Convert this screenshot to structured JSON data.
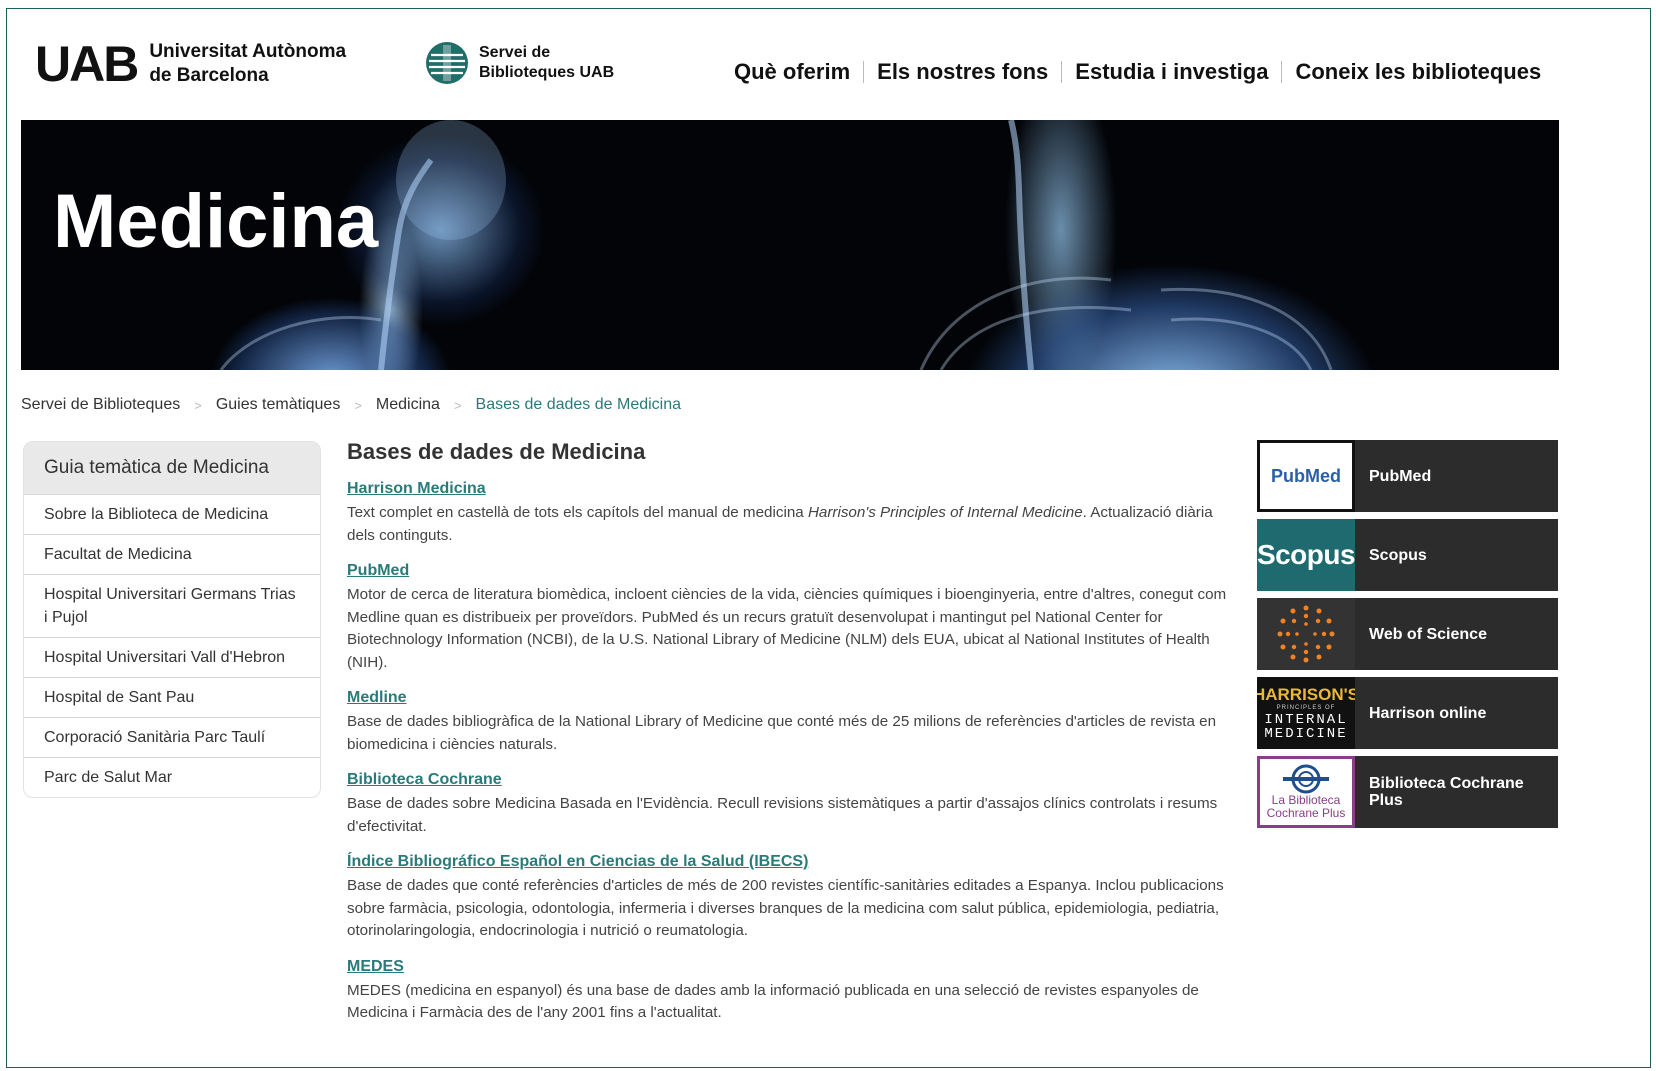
{
  "header": {
    "uab_mark": "UAB",
    "uab_line1": "Universitat Autònoma",
    "uab_line2": "de Barcelona",
    "sb_line1": "Servei de",
    "sb_line2": "Biblioteques UAB",
    "nav": [
      "Què oferim",
      "Els nostres fons",
      "Estudia i investiga",
      "Coneix les biblioteques"
    ]
  },
  "banner": {
    "title": "Medicina"
  },
  "breadcrumb": {
    "items": [
      "Servei de Biblioteques",
      "Guies temàtiques",
      "Medicina"
    ],
    "current": "Bases de dades de Medicina",
    "separator": ">"
  },
  "sidebar": {
    "title": "Guia temàtica de Medicina",
    "items": [
      "Sobre la Biblioteca de Medicina",
      "Facultat de Medicina",
      "Hospital Universitari Germans Trias i Pujol",
      "Hospital Universitari Vall d'Hebron",
      "Hospital de Sant Pau",
      "Corporació Sanitària Parc Taulí",
      "Parc de Salut Mar"
    ]
  },
  "main": {
    "heading": "Bases de dades de Medicina",
    "entries": [
      {
        "title": "Harrison Medicina",
        "desc_before": "Text complet en castellà de tots els capítols del manual de medicina ",
        "desc_italic": "Harrison's Principles of Internal Medicine",
        "desc_after": ". Actualizació diària dels continguts."
      },
      {
        "title": "PubMed",
        "desc": "Motor de cerca de literatura biomèdica, incloent ciències de la vida, ciències químiques i bioenginyeria, entre d'altres, conegut com Medline quan es distribueix per proveïdors. PubMed és un recurs gratuït desenvolupat i mantingut pel National Center for Biotechnology Information  (NCBI), de la U.S. National Library of Medicine  (NLM) dels EUA, ubicat al National Institutes of Health (NIH)."
      },
      {
        "title": "Medline",
        "desc": "Base de dades bibliogràfica de la National Library of Medicine que conté més de 25 milions de referències d'articles de revista en biomedicina i ciències naturals."
      },
      {
        "title": "Biblioteca Cochrane",
        "desc": "Base de dades sobre Medicina Basada en l'Evidència. Recull revisions sistemàtiques a partir d'assajos clínics controlats i resums d'efectivitat."
      },
      {
        "title": "Índice Bibliográfico Español en Ciencias de la Salud (IBECS)",
        "desc": "Base de dades que conté referències d'articles de més de 200 revistes científic-sanitàries editades a Espanya. Inclou publicacions sobre farmàcia, psicologia, odontologia, infermeria i diverses branques de la medicina com salut pública, epidemiologia, pediatria, otorinolaringologia, endocrinologia i nutrició o reumatologia."
      },
      {
        "title": "MEDES",
        "desc": "MEDES (medicina en espanyol) és una base de dades amb la informació publicada en una selecció de revistes espanyoles de Medicina i Farmàcia des de l'any 2001 fins a l'actualitat."
      }
    ]
  },
  "tiles": [
    {
      "label": "PubMed",
      "logo_text": "PubMed"
    },
    {
      "label": "Scopus",
      "logo_text": "Scopus"
    },
    {
      "label": "Web of Science",
      "logo_text": ""
    },
    {
      "label": "Harrison online",
      "logo_text": "HARRISON'S",
      "logo_sub": "PRINCIPLES OF",
      "logo_sub2": "INTERNAL",
      "logo_sub3": "MEDICINE"
    },
    {
      "label": "Biblioteca Cochrane Plus",
      "logo_text": "La Biblioteca",
      "logo_sub": "Cochrane Plus"
    }
  ],
  "colors": {
    "link": "#2a7a7a",
    "frame": "#1d5e5b",
    "tile_bg": "#2c2c2c",
    "scopus": "#1e6a6e",
    "wos": "#f58220",
    "cochrane_border": "#8a3d88"
  }
}
